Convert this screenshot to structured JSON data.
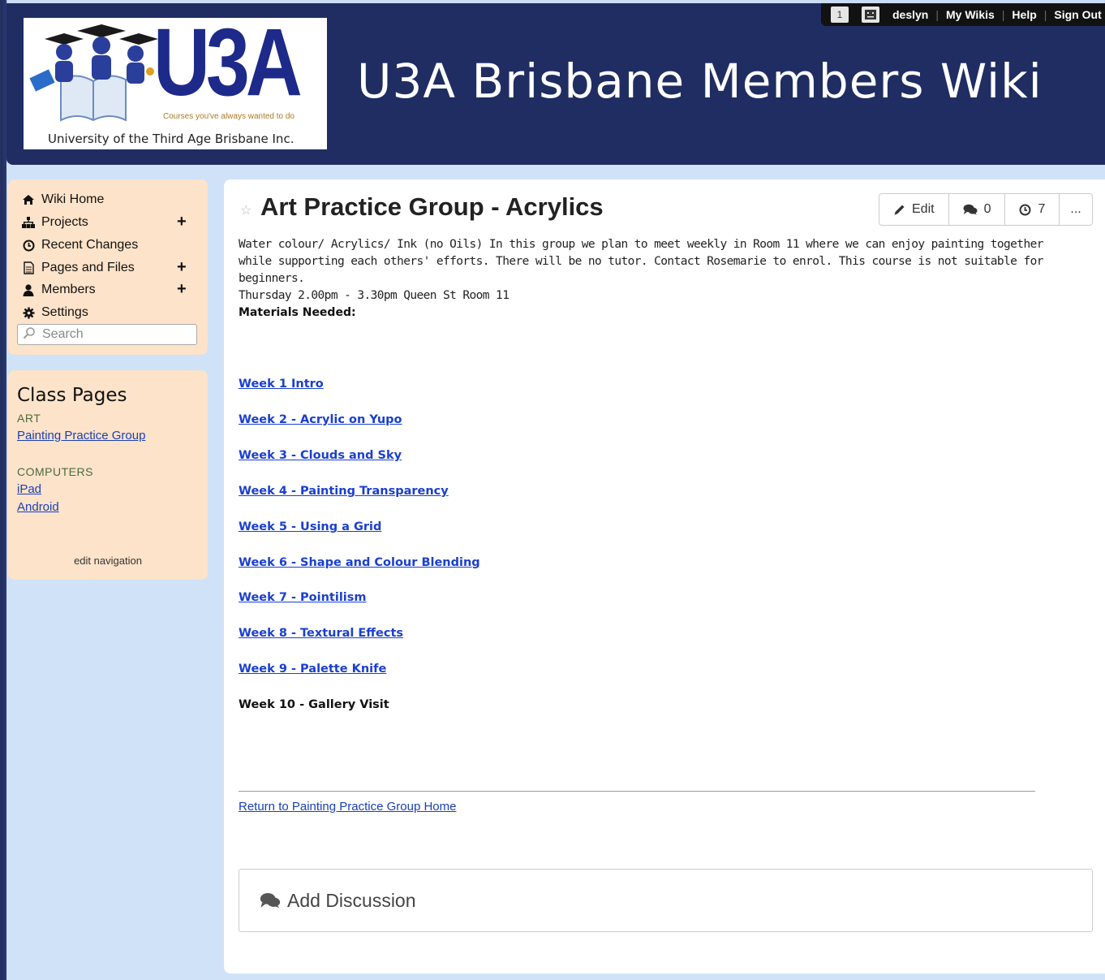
{
  "header": {
    "logo_text": "U3A",
    "logo_tagline": "Courses you've always wanted to do",
    "logo_caption": "University of the Third Age Brisbane Inc.",
    "site_title": "U3A Brisbane Members Wiki"
  },
  "topbar": {
    "notification_count": "1",
    "username": "deslyn",
    "my_wikis": "My Wikis",
    "help": "Help",
    "sign_out": "Sign Out"
  },
  "nav": {
    "items": [
      {
        "label": "Wiki Home",
        "icon": "home-icon"
      },
      {
        "label": "Projects",
        "icon": "sitemap-icon"
      },
      {
        "label": "Recent Changes",
        "icon": "clock-icon"
      },
      {
        "label": "Pages and Files",
        "icon": "file-icon"
      },
      {
        "label": "Members",
        "icon": "user-icon"
      },
      {
        "label": "Settings",
        "icon": "gear-icon"
      }
    ],
    "search_placeholder": "Search"
  },
  "class_pages": {
    "title": "Class Pages",
    "categories": [
      {
        "name": "ART",
        "links": [
          "Painting Practice Group"
        ]
      },
      {
        "name": "COMPUTERS",
        "links": [
          "iPad",
          "Android"
        ]
      }
    ],
    "edit_navigation": "edit navigation"
  },
  "page": {
    "title": "Art Practice Group - Acrylics",
    "buttons": {
      "edit": "Edit",
      "comments": "0",
      "revisions": "7",
      "more": "..."
    },
    "description_lines": [
      "Water colour/ Acrylics/ Ink (no Oils) In this group we plan to meet weekly in Room 11 where we can enjoy painting together",
      "while supporting each others' efforts. There will be no tutor. Contact Rosemarie to enrol. This course is not suitable for beginners.",
      "Thursday 2.00pm - 3.30pm Queen St Room 11"
    ],
    "materials_label": "Materials Needed:",
    "weeks": [
      "Week 1 Intro",
      "Week 2 - Acrylic on Yupo",
      "Week 3 - Clouds and Sky",
      "Week 4 - Painting Transparency",
      "Week 5 - Using a Grid",
      "Week 6 - Shape and Colour Blending",
      "Week 7 - Pointilism",
      "Week 8 - Textural Effects",
      "Week 9 - Palette Knife",
      "Week 10 - Gallery Visit"
    ],
    "return_link": "Return to Painting Practice Group Home",
    "add_discussion": "Add Discussion"
  },
  "colors": {
    "header_bg": "#1f2d62",
    "sidebar_bg": "#fde3c9",
    "link": "#1a3fd0",
    "page_bg": "#cfe2f7"
  }
}
